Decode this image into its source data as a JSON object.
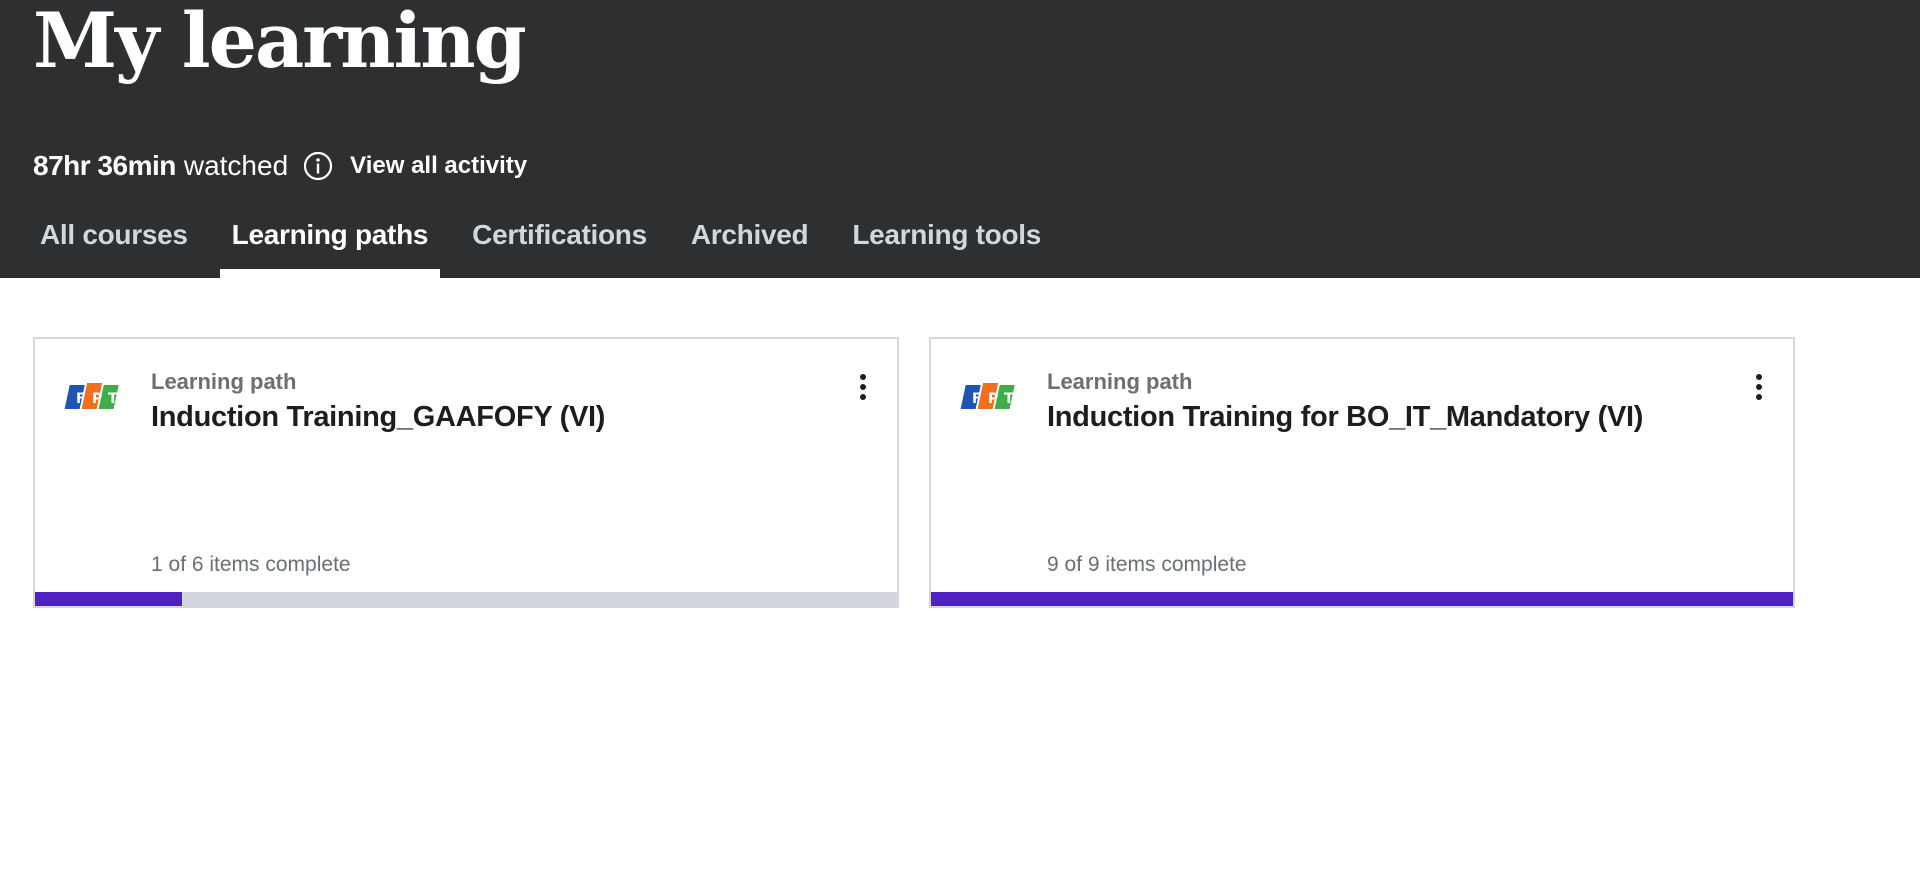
{
  "header": {
    "title": "My learning",
    "watched_hours": "87hr 36min",
    "watched_label": "watched",
    "view_activity": "View all activity"
  },
  "tabs": [
    {
      "label": "All courses",
      "active": false
    },
    {
      "label": "Learning paths",
      "active": true
    },
    {
      "label": "Certifications",
      "active": false
    },
    {
      "label": "Archived",
      "active": false
    },
    {
      "label": "Learning tools",
      "active": false
    }
  ],
  "cards": [
    {
      "type": "Learning path",
      "title": "Induction Training_GAAFOFY (VI)",
      "progress_text": "1 of 6 items complete",
      "progress": 0.17,
      "icon": "fpt-logo"
    },
    {
      "type": "Learning path",
      "title": "Induction Training for BO_IT_Mandatory (VI)",
      "progress_text": "9 of 9 items complete",
      "progress": 1.0,
      "icon": "fpt-logo"
    }
  ],
  "colors": {
    "header_bg": "#2d2f31",
    "progress_fill": "#5022c3",
    "progress_track": "#d1d7dc"
  }
}
